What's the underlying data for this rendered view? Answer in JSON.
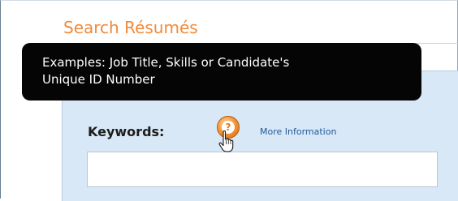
{
  "page": {
    "title": "Search Résumés"
  },
  "tooltip": {
    "line1": "Examples: Job Title, Skills or Candidate's",
    "line2": "Unique ID Number"
  },
  "search_form": {
    "keywords_label": "Keywords:",
    "help_icon": "question-mark-icon",
    "more_info_link": "More Information",
    "keywords_value": "",
    "keywords_placeholder": ""
  },
  "cursor": {
    "icon": "hand-pointer-icon"
  },
  "colors": {
    "title": "#f08a3a",
    "panel_background": "#d9e8f6",
    "tooltip_background": "#050505",
    "link": "#1f5a99",
    "help_icon": "#f39a3c"
  }
}
